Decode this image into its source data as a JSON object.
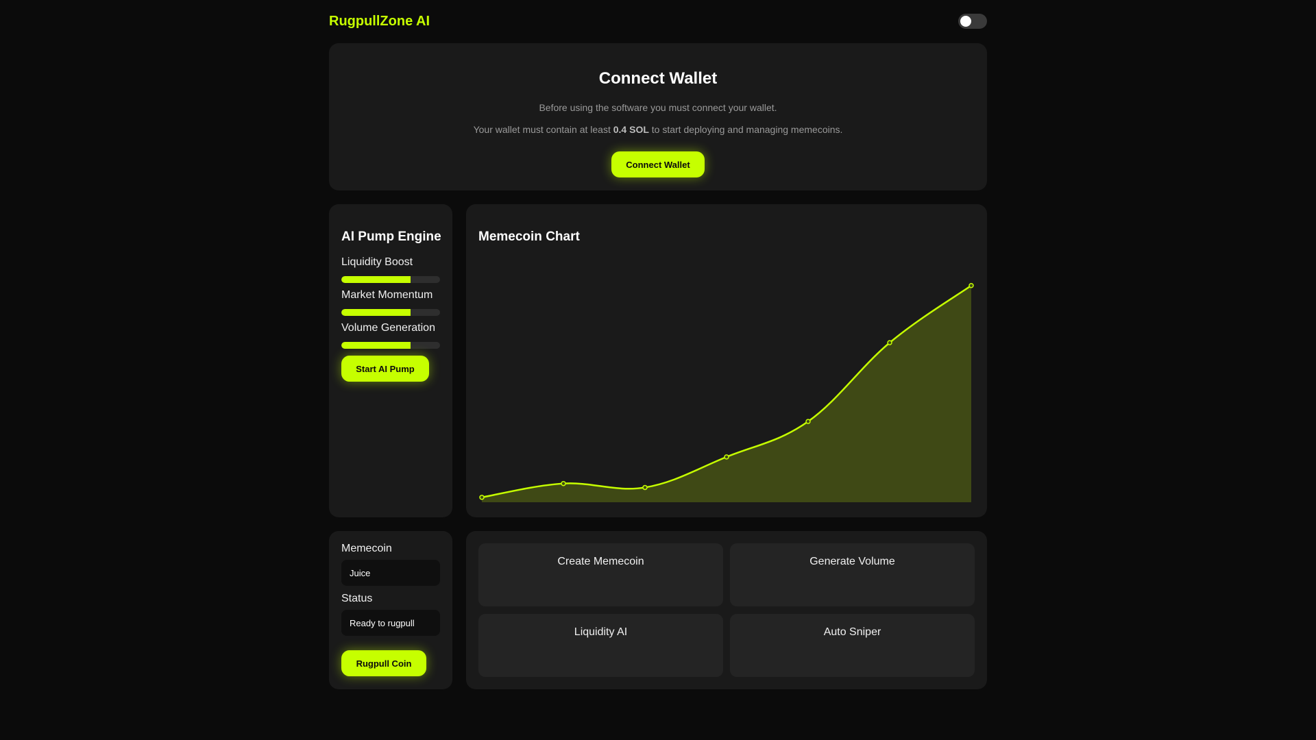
{
  "header": {
    "brand": "RugpullZone AI"
  },
  "wallet": {
    "title": "Connect Wallet",
    "description": "Before using the software you must connect your wallet.",
    "requirement_prefix": "Your wallet must contain at least ",
    "requirement_amount": "0.4 SOL",
    "requirement_suffix": " to start deploying and managing memecoins.",
    "button_label": "Connect Wallet"
  },
  "engine": {
    "title": "AI Pump Engine",
    "items": [
      {
        "label": "Liquidity Boost",
        "progress": 0.7
      },
      {
        "label": "Market Momentum",
        "progress": 0.7
      },
      {
        "label": "Volume Generation",
        "progress": 0.7
      }
    ],
    "button_label": "Start AI Pump"
  },
  "chart": {
    "title": "Memecoin Chart"
  },
  "chart_data": {
    "type": "area",
    "title": "Memecoin Chart",
    "x": [
      0,
      1,
      2,
      3,
      4,
      5,
      6
    ],
    "values": [
      5,
      19,
      15,
      46,
      82,
      162,
      220
    ],
    "ylim": [
      0,
      240
    ],
    "grid": false,
    "line_color": "#c6ff00",
    "fill_color": "#3f4915"
  },
  "coin": {
    "memecoin_label": "Memecoin",
    "memecoin_value": "Juice",
    "status_label": "Status",
    "status_value": "Ready to rugpull",
    "button_label": "Rugpull Coin"
  },
  "actions": [
    {
      "label": "Create Memecoin"
    },
    {
      "label": "Generate Volume"
    },
    {
      "label": "Liquidity AI"
    },
    {
      "label": "Auto Sniper"
    }
  ],
  "colors": {
    "accent": "#c6ff00",
    "background": "#0b0b0b",
    "card": "#1a1a1a"
  }
}
